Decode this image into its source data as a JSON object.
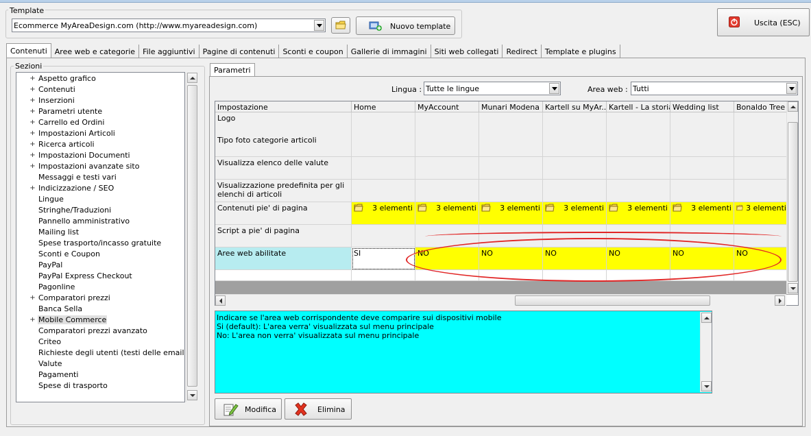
{
  "template": {
    "group_label": "Template",
    "selected": "Ecommerce MyAreaDesign.com (http://www.myareadesign.com)",
    "new_button": "Nuovo template"
  },
  "exit_button": "Uscita (ESC)",
  "tabs": [
    {
      "label": "Contenuti"
    },
    {
      "label": "Aree web e categorie"
    },
    {
      "label": "File aggiuntivi"
    },
    {
      "label": "Pagine di contenuti"
    },
    {
      "label": "Sconti e coupon"
    },
    {
      "label": "Gallerie di immagini"
    },
    {
      "label": "Siti web collegati"
    },
    {
      "label": "Redirect"
    },
    {
      "label": "Template e plugins"
    }
  ],
  "sections": {
    "label": "Sezioni",
    "items": [
      {
        "label": "Aspetto grafico",
        "expandable": true
      },
      {
        "label": "Contenuti",
        "expandable": true
      },
      {
        "label": "Inserzioni",
        "expandable": true
      },
      {
        "label": "Parametri utente",
        "expandable": true
      },
      {
        "label": "Carrello ed Ordini",
        "expandable": true
      },
      {
        "label": "Impostazioni Articoli",
        "expandable": true
      },
      {
        "label": "Ricerca articoli",
        "expandable": true
      },
      {
        "label": "Impostazioni Documenti",
        "expandable": true
      },
      {
        "label": "Impostazioni avanzate sito",
        "expandable": true
      },
      {
        "label": "Messaggi e testi vari",
        "expandable": false
      },
      {
        "label": "Indicizzazione / SEO",
        "expandable": true
      },
      {
        "label": "Lingue",
        "expandable": false
      },
      {
        "label": "Stringhe/Traduzioni",
        "expandable": false
      },
      {
        "label": "Pannello amministrativo",
        "expandable": false
      },
      {
        "label": "Mailing list",
        "expandable": false
      },
      {
        "label": "Spese trasporto/incasso gratuite",
        "expandable": false
      },
      {
        "label": "Sconti e Coupon",
        "expandable": false
      },
      {
        "label": "PayPal",
        "expandable": false
      },
      {
        "label": "PayPal Express Checkout",
        "expandable": false
      },
      {
        "label": "Pagonline",
        "expandable": false
      },
      {
        "label": "Comparatori prezzi",
        "expandable": true
      },
      {
        "label": "Banca Sella",
        "expandable": false
      },
      {
        "label": "Mobile Commerce",
        "expandable": true,
        "selected": true
      },
      {
        "label": "Comparatori prezzi avanzato",
        "expandable": false
      },
      {
        "label": "Criteo",
        "expandable": false
      },
      {
        "label": "Richieste degli utenti (testi delle email)",
        "expandable": false
      },
      {
        "label": "Valute",
        "expandable": false
      },
      {
        "label": "Pagamenti",
        "expandable": false
      },
      {
        "label": "Spese di trasporto",
        "expandable": false
      }
    ]
  },
  "params_tab": "Parametri",
  "filters": {
    "lingua_label": "Lingua :",
    "lingua_value": "Tutte le lingue",
    "area_label": "Area web :",
    "area_value": "Tutti"
  },
  "grid": {
    "columns": [
      "Impostazione",
      "Home",
      "MyAccount",
      "Munari Modena",
      "Kartell su MyAr...",
      "Kartell - La storia",
      "Wedding list",
      "Bonaldo Tree"
    ],
    "rows": [
      {
        "name": "Logo",
        "cells": [
          "",
          "",
          "",
          "",
          "",
          "",
          ""
        ],
        "style": "blank"
      },
      {
        "name": "Tipo foto categorie articoli",
        "cells": [
          "",
          "",
          "",
          "",
          "",
          "",
          ""
        ],
        "style": "blank"
      },
      {
        "name": "Visualizza elenco delle valute",
        "cells": [
          "",
          "",
          "",
          "",
          "",
          "",
          ""
        ],
        "style": "blank"
      },
      {
        "name": "Visualizzazione predefinita per gli elenchi di articoli",
        "cells": [
          "",
          "",
          "",
          "",
          "",
          "",
          ""
        ],
        "style": "blank"
      },
      {
        "name": "Contenuti pie' di pagina",
        "cells": [
          "3 elementi",
          "3 elementi",
          "3 elementi",
          "3 elementi",
          "3 elementi",
          "3 elementi",
          "3 elementi"
        ],
        "style": "elements"
      },
      {
        "name": "Script a pie' di pagina",
        "cells": [
          "",
          "",
          "",
          "",
          "",
          "",
          ""
        ],
        "style": "blank"
      },
      {
        "name": "Aree web abilitate",
        "cells": [
          "SI",
          "NO",
          "NO",
          "NO",
          "NO",
          "NO",
          "NO"
        ],
        "style": "yesno"
      }
    ]
  },
  "description": [
    "Indicare se l'area web corrispondente deve comparire sui dispositivi mobile",
    "Si (default): L'area verra' visualizzata sul menu principale",
    "No: L'area non verra' visualizzata sul menu principale"
  ],
  "buttons": {
    "modify": "Modifica",
    "delete": "Elimina"
  },
  "colors": {
    "highlight_yellow": "#ffff00",
    "desc_cyan": "#00ffff",
    "annotation_red": "#e12626",
    "selected_row": "#b7ecf0"
  },
  "icons": {
    "exit": "power-icon",
    "folder": "folder-icon",
    "new_template": "add-template-icon",
    "modify": "edit-icon",
    "delete": "delete-x-icon"
  }
}
